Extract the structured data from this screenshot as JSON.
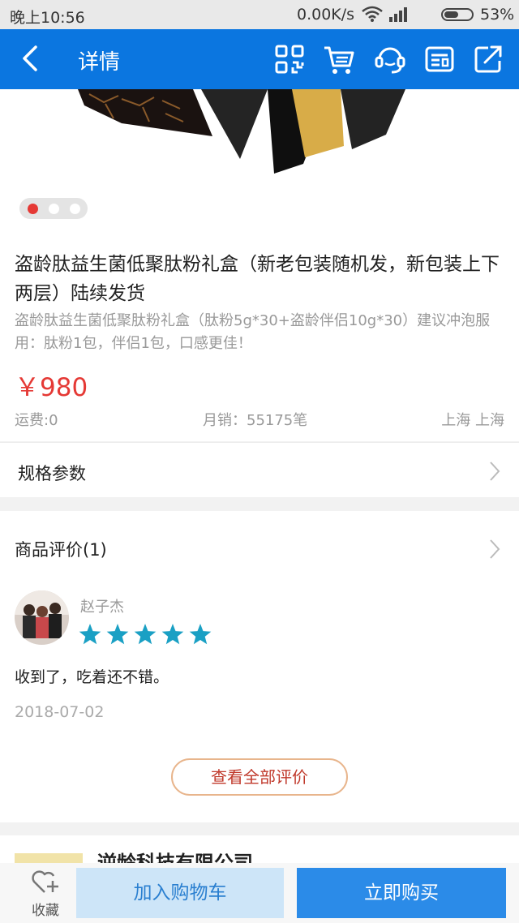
{
  "status_bar": {
    "time": "晚上10:56",
    "network_speed": "0.00K/s",
    "battery_percent": "53%",
    "battery_level": 0.53
  },
  "header": {
    "title": "详情",
    "icons": [
      "back-icon",
      "qr-code-icon",
      "cart-icon",
      "customer-service-icon",
      "card-icon",
      "share-icon"
    ]
  },
  "gallery": {
    "slide_count": 3,
    "active_slide": 1
  },
  "product": {
    "name": "盗龄肽益生菌低聚肽粉礼盒（新老包装随机发，新包装上下两层）陆续发货",
    "description": "盗龄肽益生菌低聚肽粉礼盒（肽粉5g*30+盗龄伴侣10g*30）建议冲泡服用：肽粉1包，伴侣1包，口感更佳！",
    "price": "￥980",
    "shipping": "运费:0",
    "monthly_sales": "月销：55175笔",
    "location": "上海 上海"
  },
  "spec": {
    "label": "规格参数"
  },
  "reviews": {
    "header": "商品评价(1)",
    "items": [
      {
        "reviewer": "赵子杰",
        "rating": 5,
        "comment": "收到了，吃着还不错。",
        "date": "2018-07-02"
      }
    ],
    "view_all": "查看全部评价"
  },
  "store": {
    "name": "逆龄科技有限公司"
  },
  "bottom_bar": {
    "favorite_label": "收藏",
    "add_to_cart": "加入购物车",
    "buy_now": "立即购买"
  },
  "colors": {
    "header_bg": "#0b76e0",
    "price": "#e53935",
    "star": "#1aa0c4",
    "buy_button": "#2b8be8",
    "cart_button": "#cde5f8"
  }
}
